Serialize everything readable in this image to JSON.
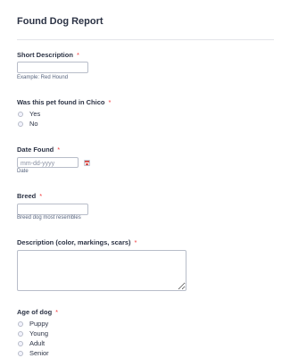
{
  "form": {
    "title": "Found Dog Report"
  },
  "fields": {
    "short_description": {
      "label": "Short Description",
      "required_mark": "*",
      "hint": "Example: Red Hound",
      "value": ""
    },
    "found_in_chico": {
      "label": "Was this pet found in Chico",
      "required_mark": "*",
      "options": [
        "Yes",
        "No"
      ]
    },
    "date_found": {
      "label": "Date Found",
      "required_mark": "*",
      "placeholder": "mm-dd-yyyy",
      "hint": "Date",
      "calendar_icon": "calendar-icon"
    },
    "breed": {
      "label": "Breed",
      "required_mark": "*",
      "hint": "Breed dog most resembles",
      "value": ""
    },
    "description": {
      "label": "Description (color, markings, scars)",
      "required_mark": "*",
      "value": ""
    },
    "age": {
      "label": "Age of dog",
      "required_mark": "*",
      "options": [
        "Puppy",
        "Young",
        "Adult",
        "Senior"
      ]
    }
  },
  "colors": {
    "text": "#2c3345",
    "required": "#f23a3c",
    "border": "#b8bdc9",
    "hint": "#57647e"
  }
}
